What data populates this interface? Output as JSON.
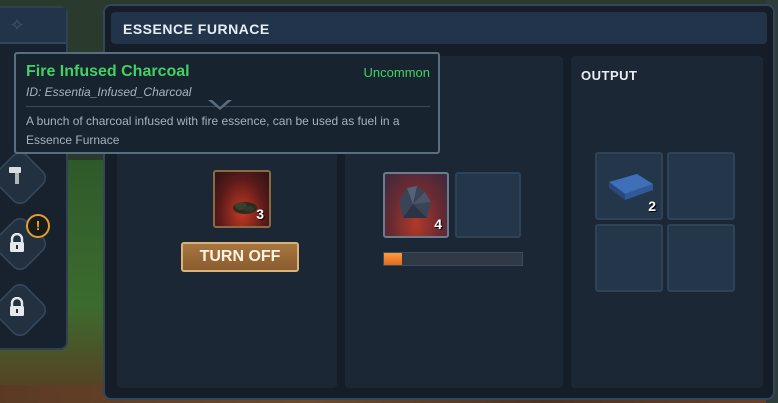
{
  "window": {
    "title": "ESSENCE FURNACE"
  },
  "sections": {
    "output_label": "OUTPUT"
  },
  "fuel": {
    "quantity": "3",
    "button_label": "TURN OFF"
  },
  "input": {
    "quantity": "4",
    "progress": 0.13
  },
  "output": {
    "quantity": "2"
  },
  "tooltip": {
    "name": "Fire Infused Charcoal",
    "rarity": "Uncommon",
    "id": "ID: Essentia_Infused_Charcoal",
    "description": "A bunch of charcoal infused with fire essence, can be used as fuel in a Essence Furnace"
  },
  "side": {
    "alert": "!"
  },
  "icons": [
    "hammer-icon",
    "lock-icon",
    "alert-icon",
    "charcoal-icon",
    "essence-ore-icon",
    "ingot-icon"
  ],
  "colors": {
    "rarity_uncommon": "#43d161",
    "progress": "#ff8a2a",
    "button": "#a87640"
  }
}
